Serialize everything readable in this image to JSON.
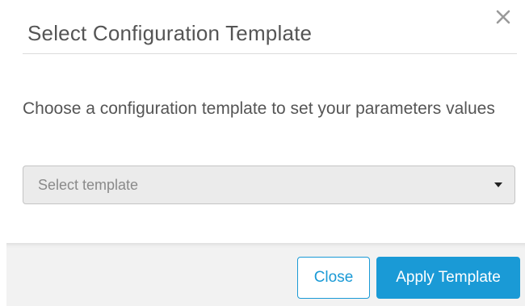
{
  "dialog": {
    "title": "Select Configuration Template",
    "description": "Choose a configuration template to set your parameters values",
    "close_icon": "close-icon"
  },
  "template_select": {
    "placeholder": "Select template",
    "icon": "caret-down-icon"
  },
  "footer": {
    "close_label": "Close",
    "apply_label": "Apply Template"
  },
  "colors": {
    "accent": "#1a9ad6",
    "title_text": "#555555",
    "select_background": "#ebebeb",
    "footer_background": "#f2f2f2"
  }
}
